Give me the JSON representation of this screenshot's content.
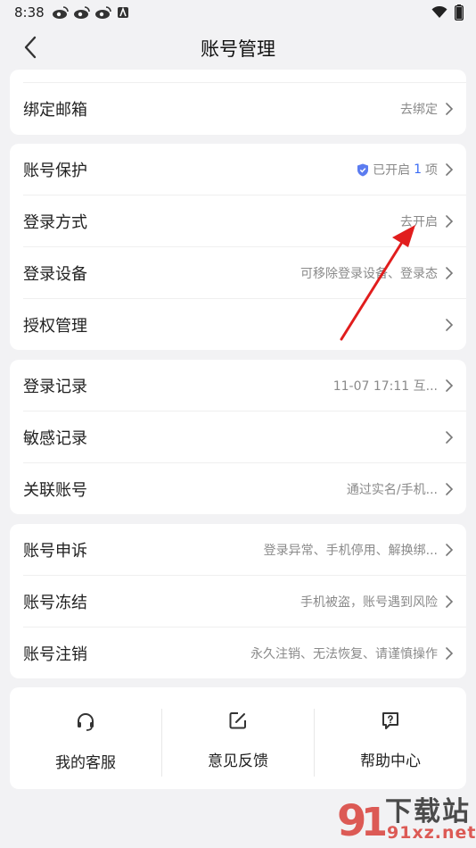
{
  "status": {
    "time": "8:38"
  },
  "header": {
    "title": "账号管理"
  },
  "card1": {
    "rows": [
      {
        "label": "绑定邮箱",
        "value": "去绑定"
      }
    ]
  },
  "card2": {
    "rows": [
      {
        "label": "账号保护",
        "value_prefix": "已开启",
        "value_count": "1",
        "value_suffix": "项"
      },
      {
        "label": "登录方式",
        "value": "去开启"
      },
      {
        "label": "登录设备",
        "value": "可移除登录设备、登录态"
      },
      {
        "label": "授权管理",
        "value": ""
      }
    ]
  },
  "card3": {
    "rows": [
      {
        "label": "登录记录",
        "value": "11-07 17:11 互..."
      },
      {
        "label": "敏感记录",
        "value": ""
      },
      {
        "label": "关联账号",
        "value": "通过实名/手机..."
      }
    ]
  },
  "card4": {
    "rows": [
      {
        "label": "账号申诉",
        "value": "登录异常、手机停用、解换绑..."
      },
      {
        "label": "账号冻结",
        "value": "手机被盗，账号遇到风险"
      },
      {
        "label": "账号注销",
        "value": "永久注销、无法恢复、请谨慎操作"
      }
    ]
  },
  "services": {
    "items": [
      {
        "label": "我的客服",
        "icon": "headset-icon"
      },
      {
        "label": "意见反馈",
        "icon": "edit-icon"
      },
      {
        "label": "帮助中心",
        "icon": "help-icon"
      }
    ]
  },
  "watermark": {
    "brand": "下载站",
    "domain": "91xz.net"
  },
  "colors": {
    "accent": "#3b6cf5",
    "shield": "#5b7cf0",
    "arrow": "#e11d1d",
    "background": "#f2f2f4"
  }
}
